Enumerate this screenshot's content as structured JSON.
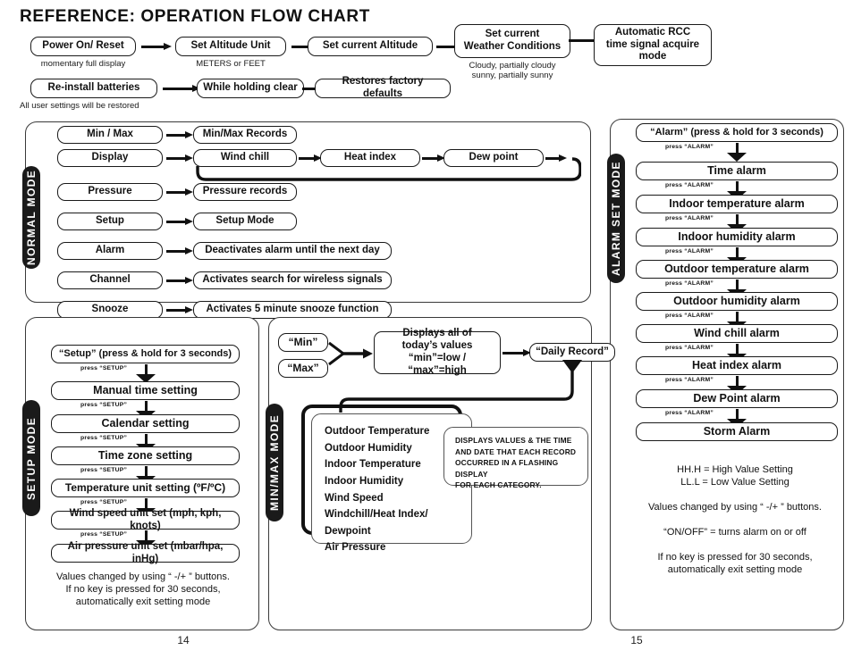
{
  "page": {
    "title": "REFERENCE: OPERATION FLOW CHART",
    "left_page_number": "14",
    "right_page_number": "15"
  },
  "top_flow": {
    "row1": [
      {
        "label": "Power On/ Reset",
        "caption": "momentary full display"
      },
      {
        "label": "Set Altitude Unit",
        "caption": "METERS or FEET"
      },
      {
        "label": "Set current Altitude",
        "caption": ""
      },
      {
        "label": "Set current\nWeather Conditions",
        "line1": "Set current",
        "line2": "Weather Conditions",
        "caption_line1": "Cloudy, partially cloudy",
        "caption_line2": "sunny, partially sunny"
      },
      {
        "line1": "Automatic RCC",
        "line2": "time signal acquire",
        "line3": "mode"
      }
    ],
    "row2": [
      {
        "label": "Re-install batteries",
        "caption": "All user settings will be restored"
      },
      {
        "label": "While holding clear"
      },
      {
        "label": "Restores factory defaults"
      }
    ]
  },
  "normal_mode": {
    "tab_label": "NORMAL MODE",
    "rows": [
      {
        "left": "Min / Max",
        "right": "Min/Max Records"
      },
      {
        "left": "Display",
        "right": "Wind chill",
        "chain": [
          "Heat index",
          "Dew point"
        ]
      },
      {
        "left": "Pressure",
        "right": "Pressure records"
      },
      {
        "left": "Setup",
        "right": "Setup Mode"
      },
      {
        "left": "Alarm",
        "right": "Deactivates alarm until the next day"
      },
      {
        "left": "Channel",
        "right": "Activates search for wireless signals"
      },
      {
        "left": "Snooze",
        "right": "Activates 5 minute snooze function"
      }
    ]
  },
  "alarm_set_mode": {
    "tab_label": "ALARM SET MODE",
    "entry": "“Alarm” (press & hold for 3 seconds)",
    "press_label": "press “ALARM”",
    "steps": [
      "Time alarm",
      "Indoor temperature alarm",
      "Indoor humidity alarm",
      "Outdoor temperature alarm",
      "Outdoor humidity alarm",
      "Wind chill alarm",
      "Heat index alarm",
      "Dew Point alarm",
      "Storm Alarm"
    ],
    "notes": [
      "HH.H = High Value Setting",
      "LL.L = Low Value Setting",
      "",
      "Values changed by using “ -/+ ” buttons.",
      "",
      "“ON/OFF” = turns alarm on or off",
      "",
      "If no key is pressed for 30 seconds,",
      "automatically exit setting mode"
    ]
  },
  "setup_mode": {
    "tab_label": "SETUP MODE",
    "entry": "“Setup” (press & hold for 3 seconds)",
    "press_label": "press “SETUP”",
    "steps": [
      "Manual time setting",
      "Calendar setting",
      "Time zone setting",
      "Temperature unit setting (ºF/ºC)",
      "Wind speed unit set (mph, kph, knots)",
      "Air pressure unit set (mbar/hpa, inHg)"
    ],
    "notes": [
      "Values changed by using “ -/+ ” buttons.",
      "If no key is pressed for 30 seconds,",
      "automatically exit setting mode"
    ]
  },
  "min_max_mode": {
    "tab_label": "MIN/MAX MODE",
    "min_button": "“Min”",
    "max_button": "“Max”",
    "display_box": {
      "line1": "Displays all of",
      "line2": "today’s values",
      "line3": "“min”=low / “max”=high"
    },
    "daily_record": "“Daily Record”",
    "categories": [
      "Outdoor Temperature",
      "Outdoor Humidity",
      "Indoor Temperature",
      "Indoor Humidity",
      "Wind Speed",
      "Windchill/Heat Index/",
      "Dewpoint",
      "Air Pressure"
    ],
    "description": [
      "DISPLAYS VALUES & THE TIME",
      "AND DATE THAT EACH RECORD",
      "OCCURRED IN A FLASHING DISPLAY",
      "FOR EACH CATEGORY."
    ]
  },
  "colors": {
    "ink": "#1a1a1a",
    "panel_border": "#3a3a3a",
    "tab_bg": "#1a1a1a",
    "tab_text": "#ffffff",
    "background": "#ffffff"
  }
}
